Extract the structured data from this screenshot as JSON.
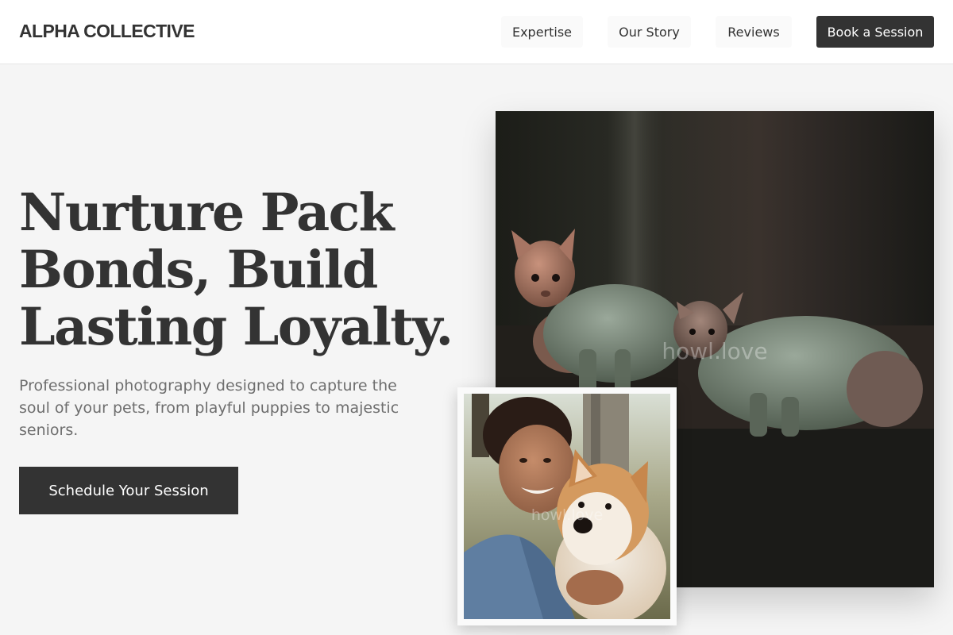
{
  "header": {
    "brand": "ALPHA COLLECTIVE",
    "nav": {
      "expertise": "Expertise",
      "story": "Our Story",
      "reviews": "Reviews"
    },
    "cta": "Book a Session"
  },
  "hero": {
    "title": "Nurture Pack Bonds, Build Lasting Loyalty.",
    "subtitle": "Professional photography designed to capture the soul of your pets, from playful puppies to majestic seniors.",
    "cta": "Schedule Your Session"
  },
  "images": {
    "main": {
      "subject": "two sphynx cats in green sweaters",
      "watermark": "howl.love"
    },
    "polaroid": {
      "subject": "smiling woman with shiba inu",
      "watermark": "howl.love"
    }
  },
  "colors": {
    "page_bg": "#f5f5f5",
    "header_bg": "#ffffff",
    "primary_dark": "#333333",
    "body_text": "#6e6e6e"
  }
}
